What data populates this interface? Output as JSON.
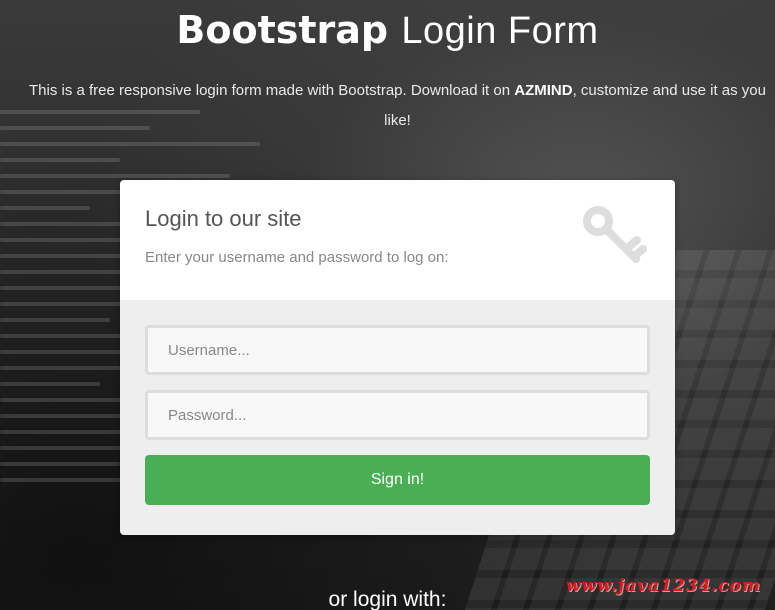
{
  "header": {
    "title_strong": "Bootstrap",
    "title_light": "Login Form",
    "description_before": "This is a free responsive login form made with Bootstrap. Download it on ",
    "description_brand": "AZMIND",
    "description_after": ", customize and use it as you like!"
  },
  "form": {
    "title": "Login to our site",
    "subtitle": "Enter your username and password to log on:",
    "icon": "key-icon",
    "username_placeholder": "Username...",
    "password_placeholder": "Password...",
    "submit_label": "Sign in!"
  },
  "social": {
    "heading": "or login with:"
  },
  "watermark": "www.java1234.com",
  "colors": {
    "accent": "#4aae54",
    "watermark": "#e3161b"
  }
}
